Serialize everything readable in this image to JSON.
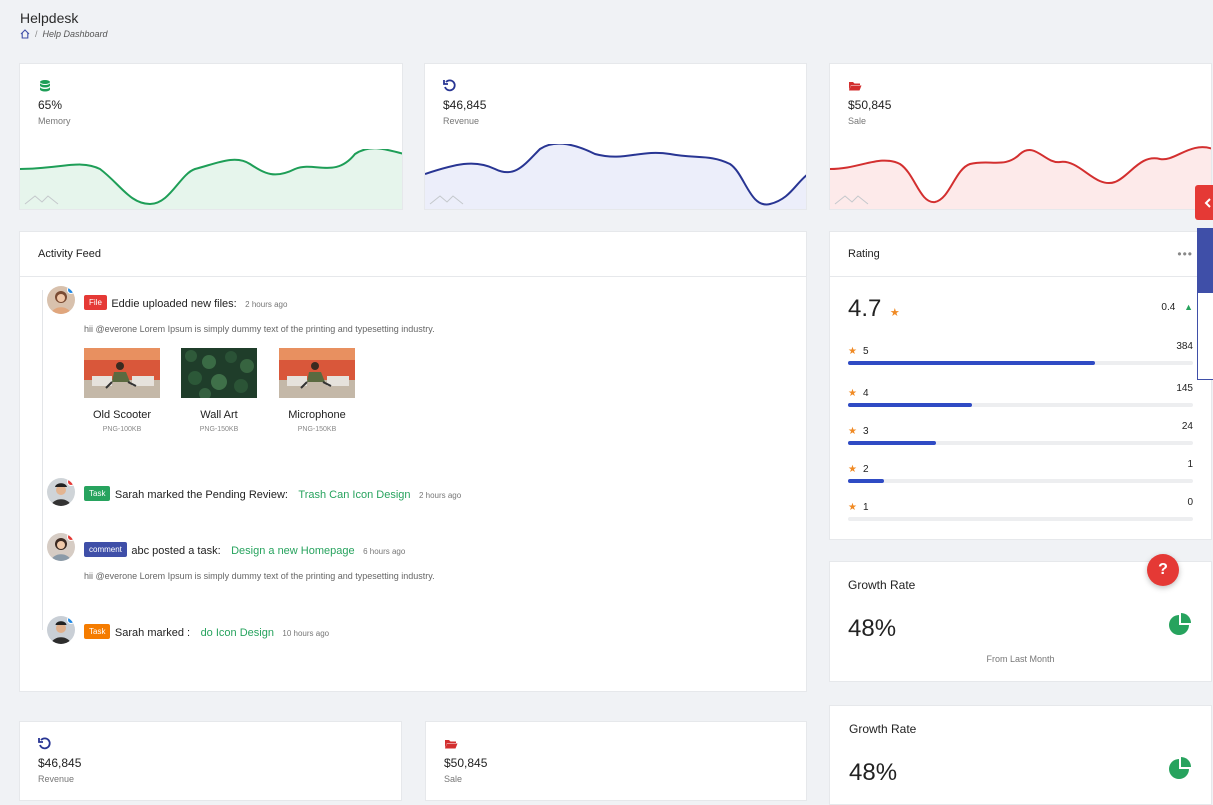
{
  "header": {
    "title": "Helpdesk",
    "breadcrumb": "Help Dashboard"
  },
  "stats": [
    {
      "value": "65%",
      "label": "Memory",
      "icon": "database-icon",
      "color": "#1e9e57",
      "fill": "#e6f5ec"
    },
    {
      "value": "$46,845",
      "label": "Revenue",
      "icon": "refresh-icon",
      "color": "#283593",
      "fill": "#eceefa"
    },
    {
      "value": "$50,845",
      "label": "Sale",
      "icon": "folder-open-icon",
      "color": "#d32f2f",
      "fill": "#fdeaea"
    }
  ],
  "bottom_stats": [
    {
      "value": "$46,845",
      "label": "Revenue",
      "icon": "refresh-icon",
      "color": "#283593"
    },
    {
      "value": "$50,845",
      "label": "Sale",
      "icon": "folder-open-icon",
      "color": "#d32f2f"
    }
  ],
  "activity": {
    "title": "Activity Feed",
    "items": [
      {
        "badge": "File",
        "badge_color": "#e53935",
        "text": "Eddie uploaded new files:",
        "link": "",
        "time": "2 hours ago",
        "desc": "hii @everone Lorem Ipsum is simply dummy text of the printing and typesetting industry.",
        "dot": "#1e88e5"
      },
      {
        "badge": "Task",
        "badge_color": "#27a35e",
        "text": "Sarah marked the Pending Review:",
        "link": "Trash Can Icon Design",
        "time": "2 hours ago",
        "desc": "",
        "dot": "#e53935"
      },
      {
        "badge": "comment",
        "badge_color": "#3f4fa8",
        "text": "abc posted a task:",
        "link": "Design a new Homepage",
        "time": "6 hours ago",
        "desc": "hii @everone Lorem Ipsum is simply dummy text of the printing and typesetting industry.",
        "dot": "#e53935"
      },
      {
        "badge": "Task",
        "badge_color": "#f57c00",
        "text": "Sarah marked :",
        "link": "do Icon Design",
        "time": "10 hours ago",
        "desc": "",
        "dot": "#1e88e5"
      }
    ],
    "files": [
      {
        "name": "Old Scooter",
        "size": "PNG-100KB"
      },
      {
        "name": "Wall Art",
        "size": "PNG-150KB"
      },
      {
        "name": "Microphone",
        "size": "PNG-150KB"
      }
    ]
  },
  "rating": {
    "title": "Rating",
    "score": "4.7",
    "change": "0.4",
    "rows": [
      {
        "stars": "5",
        "count": "384",
        "fraction": 0.715
      },
      {
        "stars": "4",
        "count": "145",
        "fraction": 0.36
      },
      {
        "stars": "3",
        "count": "24",
        "fraction": 0.255
      },
      {
        "stars": "2",
        "count": "1",
        "fraction": 0.105
      },
      {
        "stars": "1",
        "count": "0",
        "fraction": 0
      }
    ]
  },
  "growth": [
    {
      "title": "Growth Rate",
      "value": "48%",
      "caption": "From Last Month"
    },
    {
      "title": "Growth Rate",
      "value": "48%"
    }
  ]
}
